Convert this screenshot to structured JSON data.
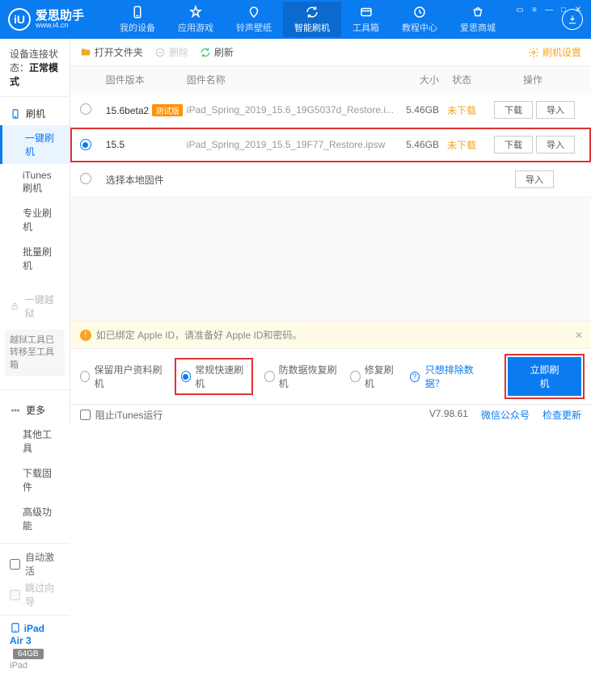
{
  "app": {
    "name": "爱思助手",
    "url": "www.i4.cn",
    "logo_letter": "iU"
  },
  "nav": {
    "items": [
      {
        "label": "我的设备"
      },
      {
        "label": "应用游戏"
      },
      {
        "label": "铃声壁纸"
      },
      {
        "label": "智能刷机",
        "active": true
      },
      {
        "label": "工具箱"
      },
      {
        "label": "教程中心"
      },
      {
        "label": "爱思商城"
      }
    ]
  },
  "sidebar": {
    "status_label": "设备连接状态：",
    "status_value": "正常模式",
    "flash": {
      "title": "刷机",
      "items": [
        {
          "label": "一键刷机",
          "active": true
        },
        {
          "label": "iTunes刷机"
        },
        {
          "label": "专业刷机"
        },
        {
          "label": "批量刷机"
        }
      ]
    },
    "jailbreak": {
      "title": "一键越狱",
      "info": "越狱工具已转移至工具箱"
    },
    "more": {
      "title": "更多",
      "items": [
        {
          "label": "其他工具"
        },
        {
          "label": "下载固件"
        },
        {
          "label": "高级功能"
        }
      ]
    },
    "auto_activate": "自动激活",
    "skip_guide": "跳过向导",
    "device": {
      "name": "iPad Air 3",
      "storage": "64GB",
      "type": "iPad"
    }
  },
  "toolbar": {
    "open": "打开文件夹",
    "delete": "删除",
    "refresh": "刷新",
    "settings": "刷机设置"
  },
  "table": {
    "headers": {
      "version": "固件版本",
      "name": "固件名称",
      "size": "大小",
      "status": "状态",
      "ops": "操作"
    },
    "rows": [
      {
        "selected": false,
        "version": "15.6beta2",
        "beta": "测试版",
        "name": "iPad_Spring_2019_15.6_19G5037d_Restore.i...",
        "size": "5.46GB",
        "status": "未下载"
      },
      {
        "selected": true,
        "version": "15.5",
        "beta": "",
        "name": "iPad_Spring_2019_15.5_19F77_Restore.ipsw",
        "size": "5.46GB",
        "status": "未下载"
      }
    ],
    "local_row": "选择本地固件",
    "btn_download": "下载",
    "btn_import": "导入"
  },
  "warn": "如已绑定 Apple ID，请准备好 Apple ID和密码。",
  "options": {
    "keep": "保留用户资料刷机",
    "normal": "常规快速刷机",
    "antirec": "防数据恢复刷机",
    "repair": "修复刷机",
    "exclude": "只想排除数据？",
    "flash_now": "立即刷机"
  },
  "statusbar": {
    "block": "阻止iTunes运行",
    "version": "V7.98.61",
    "wechat": "微信公众号",
    "check": "检查更新"
  }
}
